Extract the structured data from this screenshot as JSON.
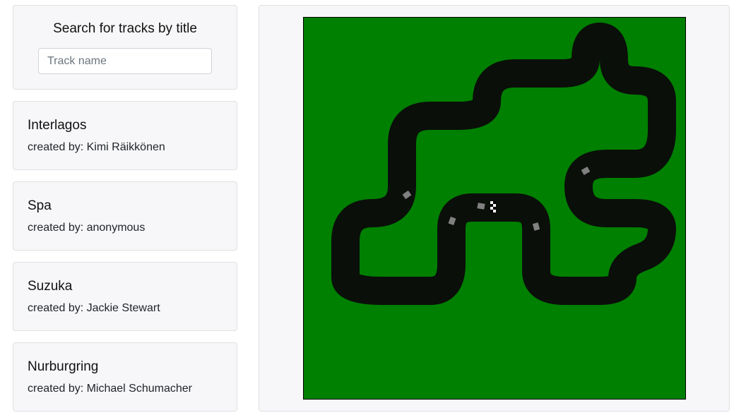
{
  "search": {
    "title": "Search for tracks by title",
    "placeholder": "Track name",
    "value": ""
  },
  "tracks": [
    {
      "title": "Interlagos",
      "creator": "created by: Kimi Räikkönen"
    },
    {
      "title": "Spa",
      "creator": "created by: anonymous"
    },
    {
      "title": "Suzuka",
      "creator": "created by: Jackie Stewart"
    },
    {
      "title": "Nurburgring",
      "creator": "created by: Michael Schumacher"
    }
  ],
  "preview": {
    "grass_color": "#008000",
    "asphalt_color": "#0a0f0a",
    "car_color": "#808080",
    "finish_line": "checkered-flag"
  }
}
